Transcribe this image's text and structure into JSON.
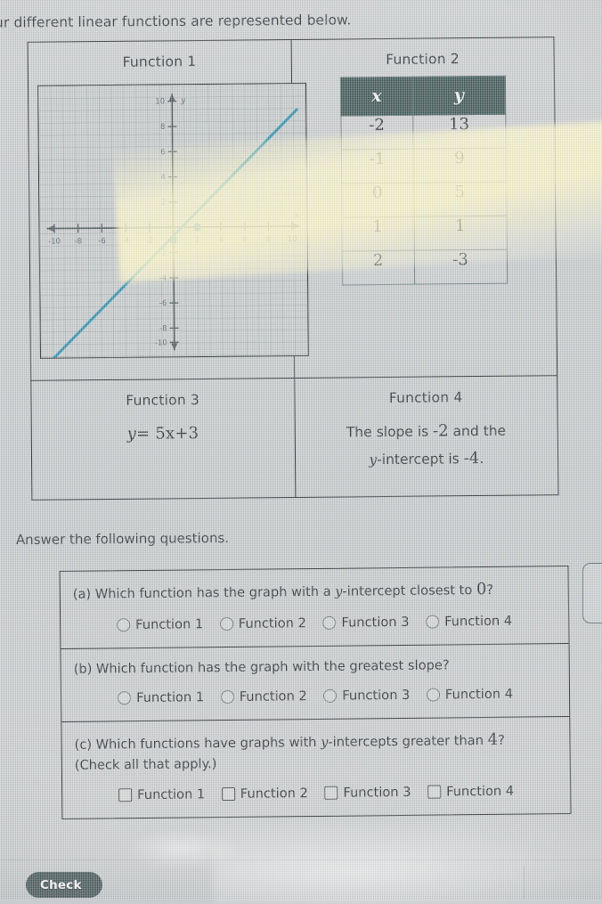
{
  "intro_text": "ur different linear functions are represented below.",
  "functions": {
    "f1": {
      "title": "Function 1",
      "graph": {
        "x_axis_label": "x",
        "y_axis_label": "y",
        "x_ticks": [
          "-10",
          "-8",
          "-6",
          "-4",
          "-2",
          "2",
          "4",
          "6",
          "8",
          "10"
        ],
        "y_ticks": [
          "10",
          "8",
          "6",
          "4",
          "2",
          "-2",
          "-4",
          "-6",
          "-8",
          "-10"
        ],
        "line_color": "#2590b0",
        "slope": 1,
        "y_intercept": -1,
        "xlim": [
          -11,
          11
        ],
        "ylim": [
          -11,
          11
        ]
      }
    },
    "f2": {
      "title": "Function 2",
      "table": {
        "headers": [
          "x",
          "y"
        ],
        "rows": [
          [
            "-2",
            "13"
          ],
          [
            "-1",
            "9"
          ],
          [
            "0",
            "5"
          ],
          [
            "1",
            "1"
          ],
          [
            "2",
            "-3"
          ]
        ]
      }
    },
    "f3": {
      "title": "Function 3",
      "equation_y": "y",
      "equation_rest": "= 5x+3"
    },
    "f4": {
      "title": "Function 4",
      "line1_pre": "The slope is ",
      "line1_num": "-2",
      "line1_post": " and the",
      "line2_var": "y",
      "line2_mid": "-intercept is ",
      "line2_num": "-4",
      "line2_end": "."
    }
  },
  "answer_prompt": "Answer the following questions.",
  "questions": [
    {
      "id": "a",
      "text_pre": "(a) Which function has the graph with a ",
      "text_var": "y",
      "text_mid": "-intercept closest to ",
      "text_num": "0",
      "text_end": "?",
      "input_type": "radio",
      "choices": [
        "Function 1",
        "Function 2",
        "Function 3",
        "Function 4"
      ]
    },
    {
      "id": "b",
      "text_pre": "(b) Which function has the graph with the greatest slope?",
      "text_var": "",
      "text_mid": "",
      "text_num": "",
      "text_end": "",
      "input_type": "radio",
      "choices": [
        "Function 1",
        "Function 2",
        "Function 3",
        "Function 4"
      ]
    },
    {
      "id": "c",
      "text_pre": "(c) Which functions have graphs with ",
      "text_var": "y",
      "text_mid": "-intercepts greater than ",
      "text_num": "4",
      "text_end": "?",
      "text_line2": "(Check all that apply.)",
      "input_type": "checkbox",
      "choices": [
        "Function 1",
        "Function 2",
        "Function 3",
        "Function 4"
      ]
    }
  ],
  "footer": {
    "check_label": "Check"
  },
  "colors": {
    "table_header_bg": "#3c5553",
    "graph_line": "#2590b0",
    "check_button_bg": "#465759",
    "page_bg": "#c8cccd",
    "border": "#22282c"
  },
  "chart_data": {
    "type": "line",
    "title": "Function 1",
    "xlabel": "x",
    "ylabel": "y",
    "xlim": [
      -11,
      11
    ],
    "ylim": [
      -11,
      11
    ],
    "grid": true,
    "series": [
      {
        "name": "Function 1",
        "slope": 1,
        "intercept": -1,
        "x": [
          -10,
          -5,
          0,
          5,
          10
        ],
        "y": [
          -11,
          -6,
          -1,
          4,
          9
        ]
      }
    ],
    "xticks": [
      -10,
      -8,
      -6,
      -4,
      -2,
      2,
      4,
      6,
      8,
      10
    ],
    "yticks": [
      -10,
      -8,
      -6,
      -4,
      -2,
      2,
      4,
      6,
      8,
      10
    ],
    "marked_points": [
      [
        0,
        -1
      ],
      [
        1,
        0
      ]
    ]
  }
}
